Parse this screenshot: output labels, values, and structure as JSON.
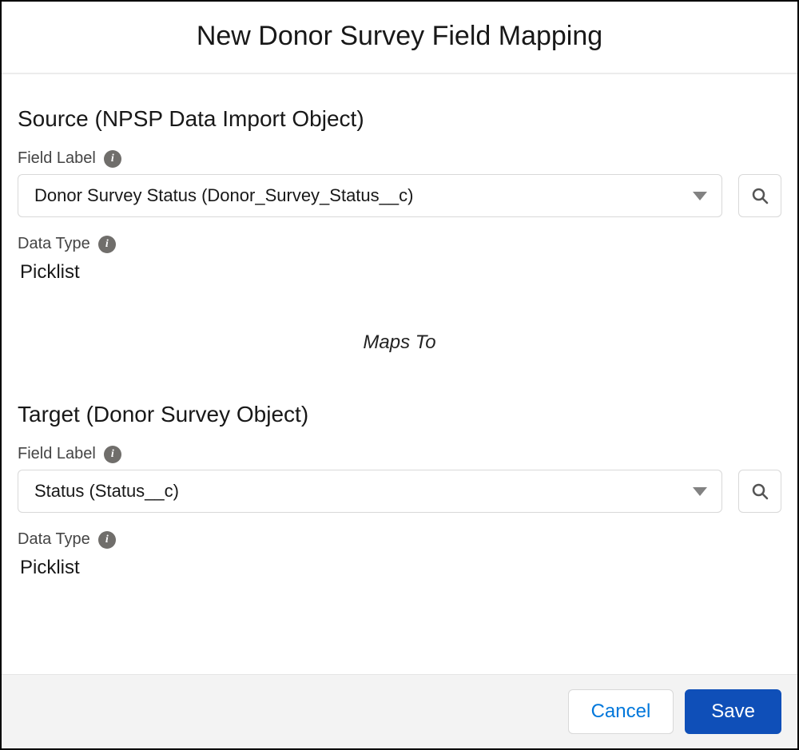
{
  "modal": {
    "title": "New Donor Survey Field Mapping"
  },
  "source": {
    "heading": "Source (NPSP Data Import Object)",
    "field_label_caption": "Field Label",
    "field_label_value": "Donor Survey Status (Donor_Survey_Status__c)",
    "data_type_caption": "Data Type",
    "data_type_value": "Picklist"
  },
  "maps_to_text": "Maps To",
  "target": {
    "heading": "Target (Donor Survey Object)",
    "field_label_caption": "Field Label",
    "field_label_value": "Status (Status__c)",
    "data_type_caption": "Data Type",
    "data_type_value": "Picklist"
  },
  "footer": {
    "cancel_label": "Cancel",
    "save_label": "Save"
  },
  "info_glyph": "i"
}
